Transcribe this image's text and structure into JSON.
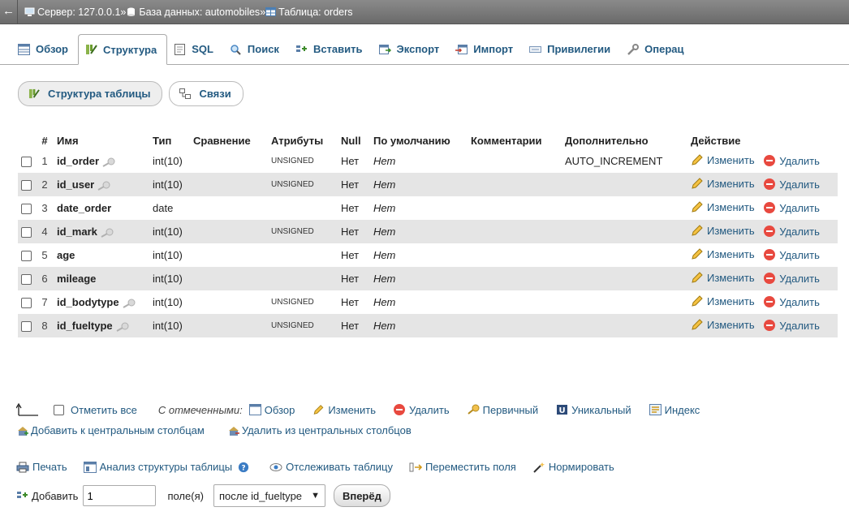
{
  "breadcrumb": {
    "server": "Сервер: 127.0.0.1",
    "sep1": "»",
    "database": "База данных: automobiles",
    "sep2": "»",
    "table": "Таблица: orders"
  },
  "tabs": [
    {
      "label": "Обзор"
    },
    {
      "label": "Структура"
    },
    {
      "label": "SQL"
    },
    {
      "label": "Поиск"
    },
    {
      "label": "Вставить"
    },
    {
      "label": "Экспорт"
    },
    {
      "label": "Импорт"
    },
    {
      "label": "Привилегии"
    },
    {
      "label": "Операц"
    }
  ],
  "subtabs": {
    "structure": "Структура таблицы",
    "relations": "Связи"
  },
  "table": {
    "headers": [
      "#",
      "Имя",
      "Тип",
      "Сравнение",
      "Атрибуты",
      "Null",
      "По умолчанию",
      "Комментарии",
      "Дополнительно",
      "Действие"
    ],
    "rows": [
      {
        "num": "1",
        "name": "id_order",
        "type": "int(10)",
        "attr": "UNSIGNED",
        "null": "Нет",
        "default": "Нет",
        "extra": "AUTO_INCREMENT"
      },
      {
        "num": "2",
        "name": "id_user",
        "type": "int(10)",
        "attr": "UNSIGNED",
        "null": "Нет",
        "default": "Нет",
        "extra": ""
      },
      {
        "num": "3",
        "name": "date_order",
        "type": "date",
        "attr": "",
        "null": "Нет",
        "default": "Нет",
        "extra": ""
      },
      {
        "num": "4",
        "name": "id_mark",
        "type": "int(10)",
        "attr": "UNSIGNED",
        "null": "Нет",
        "default": "Нет",
        "extra": ""
      },
      {
        "num": "5",
        "name": "age",
        "type": "int(10)",
        "attr": "",
        "null": "Нет",
        "default": "Нет",
        "extra": ""
      },
      {
        "num": "6",
        "name": "mileage",
        "type": "int(10)",
        "attr": "",
        "null": "Нет",
        "default": "Нет",
        "extra": ""
      },
      {
        "num": "7",
        "name": "id_bodytype",
        "type": "int(10)",
        "attr": "UNSIGNED",
        "null": "Нет",
        "default": "Нет",
        "extra": ""
      },
      {
        "num": "8",
        "name": "id_fueltype",
        "type": "int(10)",
        "attr": "UNSIGNED",
        "null": "Нет",
        "default": "Нет",
        "extra": ""
      }
    ],
    "action_edit": "Изменить",
    "action_delete": "Удалить"
  },
  "bulk": {
    "check_all": "Отметить все",
    "with_selected": "С отмеченными:",
    "browse": "Обзор",
    "change": "Изменить",
    "drop": "Удалить",
    "primary": "Первичный",
    "unique": "Уникальный",
    "index": "Индекс"
  },
  "central": {
    "add": "Добавить к центральным столбцам",
    "remove": "Удалить из центральных столбцов"
  },
  "tools": {
    "print": "Печать",
    "analyze": "Анализ структуры таблицы",
    "track": "Отслеживать таблицу",
    "move": "Переместить поля",
    "normalize": "Нормировать"
  },
  "add_columns": {
    "label": "Добавить",
    "count": "1",
    "unit": "поле(я)",
    "position": "после id_fueltype",
    "go": "Вперёд"
  },
  "colors": {
    "link": "#235a81",
    "row_alt": "#e5e5e5",
    "crumb_bg": "#7a7a7a"
  }
}
